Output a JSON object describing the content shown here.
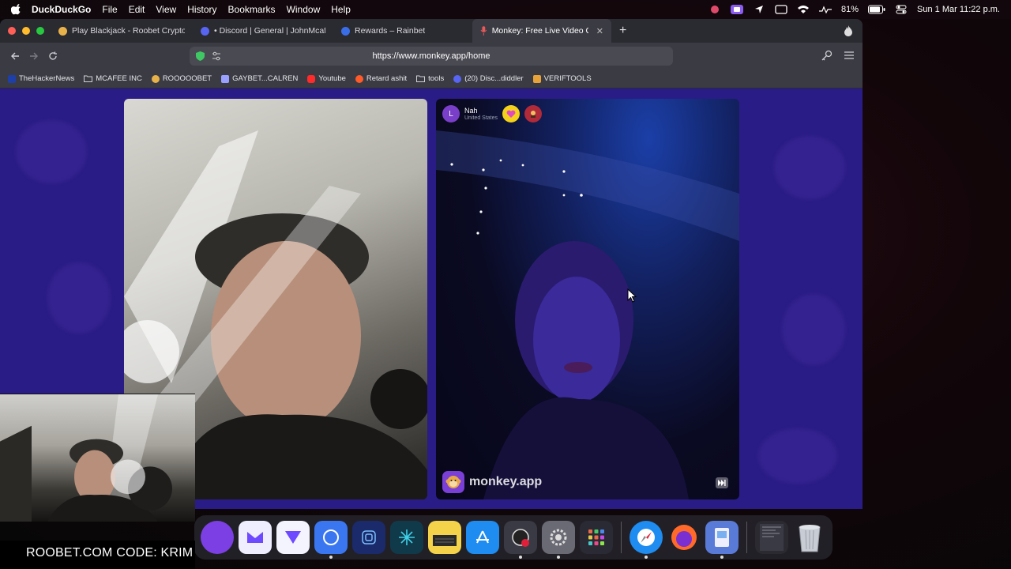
{
  "menubar": {
    "app_name": "DuckDuckGo",
    "menus": [
      "File",
      "Edit",
      "View",
      "History",
      "Bookmarks",
      "Window",
      "Help"
    ],
    "battery": "81%",
    "datetime": "Sun 1 Mar  11:22 p.m."
  },
  "tabs": [
    {
      "label": "Play Blackjack - Roobet Crypto C",
      "favicon_color": "#e8b24a"
    },
    {
      "label": "• Discord | General | JohnMcafee",
      "favicon_color": "#5865f2"
    },
    {
      "label": "Rewards – Rainbet",
      "favicon_color": "#3a6ee8"
    },
    {
      "label": "Monkey: Free Live Video C",
      "favicon_color": "#e85a5a",
      "active": true
    }
  ],
  "url": "https://www.monkey.app/home",
  "bookmarks": [
    {
      "label": "TheHackerNews",
      "icon": "thn-icon",
      "color": "#1f3fa8"
    },
    {
      "label": "MCAFEE INC",
      "icon": "folder-icon",
      "color": "#cfcfd4"
    },
    {
      "label": "ROOOOOBET",
      "icon": "roobet-icon",
      "color": "#e8b24a"
    },
    {
      "label": "GAYBET...CALREN",
      "icon": "gaybet-icon",
      "color": "#9aa0ff"
    },
    {
      "label": "Youtube",
      "icon": "youtube-icon",
      "color": "#ff2a2a"
    },
    {
      "label": "Retard ashit",
      "icon": "reddit-icon",
      "color": "#ff5a2a"
    },
    {
      "label": "tools",
      "icon": "folder-icon",
      "color": "#cfcfd4"
    },
    {
      "label": "(20) Disc...diddler",
      "icon": "discord-icon",
      "color": "#5865f2"
    },
    {
      "label": "VERIFTOOLS",
      "icon": "veriftools-icon",
      "color": "#e8a23a"
    }
  ],
  "peer": {
    "initial": "L",
    "name": "Nah",
    "country": "United States"
  },
  "brand": {
    "text": "monkey.app"
  },
  "overlay": {
    "caption": "ROOBET.COM CODE: KRIM"
  },
  "dock": [
    {
      "name": "tor-browser-icon",
      "color": "#7b3fe4"
    },
    {
      "name": "proton-mail-icon",
      "color": "#eeeeff"
    },
    {
      "name": "proton-vpn-icon",
      "color": "#f4f4ff"
    },
    {
      "name": "signal-icon",
      "color": "#3a76f0"
    },
    {
      "name": "fingerprint-app-icon",
      "color": "#1b2a6b"
    },
    {
      "name": "perplexity-icon",
      "color": "#103a4a"
    },
    {
      "name": "notes-icon",
      "color": "#f4d24a"
    },
    {
      "name": "app-store-icon",
      "color": "#1e8cf0"
    },
    {
      "name": "screen-recorder-icon",
      "color": "#3a3a44"
    },
    {
      "name": "system-settings-icon",
      "color": "#6a6a74"
    },
    {
      "name": "launchpad-icon",
      "color": "#2a2a34"
    },
    {
      "name": "safari-icon",
      "color": "#1e8cf0"
    },
    {
      "name": "firefox-icon",
      "color": "#ff6a2a"
    },
    {
      "name": "preview-icon",
      "color": "#5a7ad8"
    },
    {
      "name": "downloads-stack-icon",
      "color": "#2a2a30"
    },
    {
      "name": "trash-icon",
      "color": "#bfc4cc"
    }
  ]
}
